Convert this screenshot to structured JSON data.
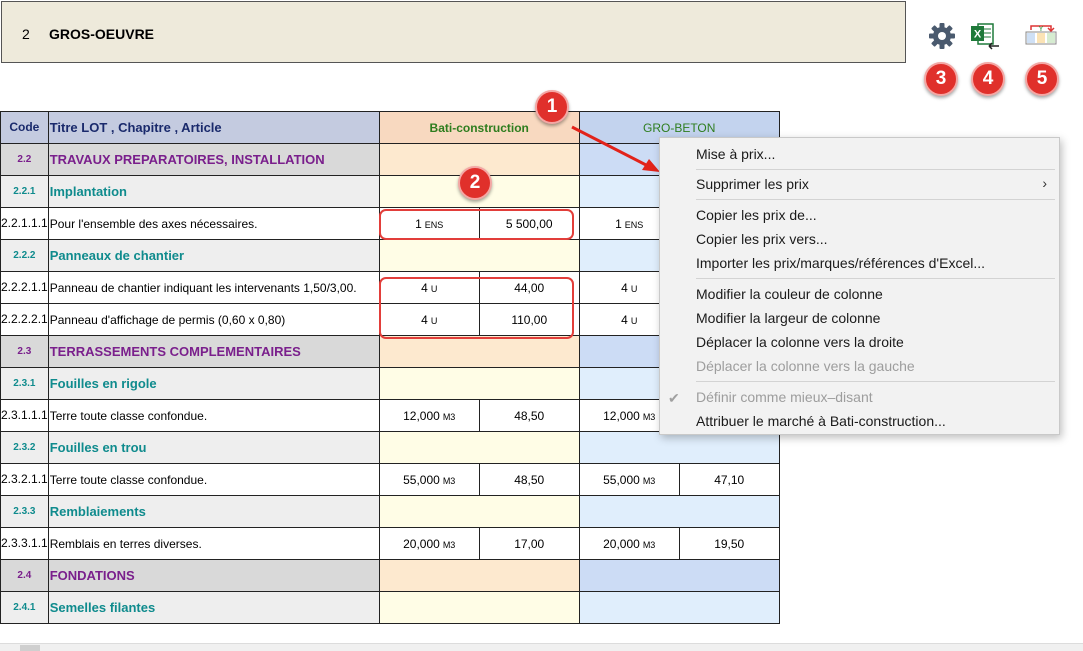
{
  "header": {
    "number": "2",
    "title": "GROS-OEUVRE"
  },
  "toolbar": {
    "icons": [
      "gear-icon",
      "excel-export-icon",
      "compare-columns-icon"
    ],
    "badges": [
      "3",
      "4",
      "5"
    ]
  },
  "callouts": [
    "1",
    "2"
  ],
  "table": {
    "col_code": "Code",
    "col_title": "Titre LOT , Chapitre , Article",
    "companies": [
      "Bati-construction",
      "GRO-BETON"
    ],
    "rows": [
      {
        "type": "chap",
        "code": "2.2",
        "title": "TRAVAUX PREPARATOIRES, INSTALLATION"
      },
      {
        "type": "sub",
        "code": "2.2.1",
        "title": "Implantation"
      },
      {
        "type": "item",
        "code": "2.2.1.1.1",
        "title": "Pour l'ensemble des axes nécessaires.",
        "q1": "1",
        "u1": "ENS",
        "p1": "5 500,00",
        "q2": "1",
        "u2": "ENS",
        "p2": ""
      },
      {
        "type": "sub",
        "code": "2.2.2",
        "title": "Panneaux de chantier"
      },
      {
        "type": "item",
        "code": "2.2.2.1.1",
        "title": "Panneau de chantier indiquant les intervenants 1,50/3,00.",
        "q1": "4",
        "u1": "U",
        "p1": "44,00",
        "q2": "4",
        "u2": "U",
        "p2": ""
      },
      {
        "type": "item",
        "code": "2.2.2.2.1",
        "title": "Panneau d'affichage de permis (0,60 x 0,80)",
        "q1": "4",
        "u1": "U",
        "p1": "110,00",
        "q2": "4",
        "u2": "U",
        "p2": ""
      },
      {
        "type": "chap",
        "code": "2.3",
        "title": "TERRASSEMENTS COMPLEMENTAIRES"
      },
      {
        "type": "sub",
        "code": "2.3.1",
        "title": "Fouilles en rigole"
      },
      {
        "type": "item",
        "code": "2.3.1.1.1",
        "title": "Terre toute classe confondue.",
        "q1": "12,000",
        "u1": "M3",
        "p1": "48,50",
        "q2": "12,000",
        "u2": "M3",
        "p2": ""
      },
      {
        "type": "sub",
        "code": "2.3.2",
        "title": "Fouilles en trou"
      },
      {
        "type": "item",
        "code": "2.3.2.1.1",
        "title": "Terre toute classe confondue.",
        "q1": "55,000",
        "u1": "M3",
        "p1": "48,50",
        "q2": "55,000",
        "u2": "M3",
        "p2": "47,10"
      },
      {
        "type": "sub",
        "code": "2.3.3",
        "title": "Remblaiements"
      },
      {
        "type": "item",
        "code": "2.3.3.1.1",
        "title": "Remblais en terres diverses.",
        "q1": "20,000",
        "u1": "M3",
        "p1": "17,00",
        "q2": "20,000",
        "u2": "M3",
        "p2": "19,50"
      },
      {
        "type": "chap",
        "code": "2.4",
        "title": "FONDATIONS"
      },
      {
        "type": "sub",
        "code": "2.4.1",
        "title": "Semelles filantes"
      }
    ]
  },
  "context_menu": {
    "items": [
      {
        "label": "Mise à prix...",
        "enabled": true
      },
      {
        "label": "Supprimer les prix",
        "enabled": true,
        "submenu": true
      },
      {
        "label": "Copier les prix de...",
        "enabled": true
      },
      {
        "label": "Copier les prix vers...",
        "enabled": true
      },
      {
        "label": "Importer les prix/marques/références d'Excel...",
        "enabled": true
      },
      {
        "label": "Modifier la couleur de colonne",
        "enabled": true
      },
      {
        "label": "Modifier la largeur de colonne",
        "enabled": true
      },
      {
        "label": "Déplacer la colonne vers la droite",
        "enabled": true
      },
      {
        "label": "Déplacer la colonne vers la gauche",
        "enabled": false
      },
      {
        "label": "Définir comme mieux–disant",
        "enabled": false,
        "checked": true
      },
      {
        "label": "Attribuer le marché à Bati-construction...",
        "enabled": true
      }
    ]
  },
  "colors": {
    "badge": "#e0302b",
    "chapter_text": "#7a1f8c",
    "subchapter_text": "#0f8b8d",
    "company_text": "#2e7d1e"
  }
}
